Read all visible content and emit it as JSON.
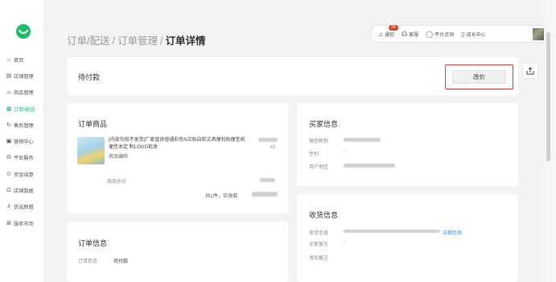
{
  "sidebar": {
    "items": [
      {
        "label": "首页",
        "icon": "home-icon",
        "glyph": "⌂",
        "active": false
      },
      {
        "label": "店铺管理",
        "icon": "shop-icon",
        "glyph": "▤",
        "active": false
      },
      {
        "label": "商品管理",
        "icon": "bag-icon",
        "glyph": "⌓",
        "active": false
      },
      {
        "label": "订单/配送",
        "icon": "order-icon",
        "glyph": "▦",
        "active": true
      },
      {
        "label": "售后管理",
        "icon": "refund-icon",
        "glyph": "↻",
        "active": false
      },
      {
        "label": "营销中心",
        "icon": "marketing-icon",
        "glyph": "▣",
        "active": false
      },
      {
        "label": "平台服务",
        "icon": "service-icon",
        "glyph": "⊟",
        "active": false
      },
      {
        "label": "资金结算",
        "icon": "money-icon",
        "glyph": "⊙",
        "active": false
      },
      {
        "label": "店铺数据",
        "icon": "data-icon",
        "glyph": "⊡",
        "active": false
      },
      {
        "label": "优选联盟",
        "icon": "union-icon",
        "glyph": "⅄",
        "active": false
      },
      {
        "label": "服务市场",
        "icon": "market-icon",
        "glyph": "⊞",
        "active": false
      }
    ]
  },
  "breadcrumb": {
    "item1": "订单/配送",
    "item2": "订单管理",
    "current": "订单详情",
    "separator": "/"
  },
  "toolbar": {
    "notify_label": "通知",
    "notify_badge": "34",
    "service_label": "客服",
    "feedback_label": "平台咨询",
    "growth_label": "成长中心"
  },
  "status": {
    "title": "待付款",
    "reprice_label": "改价"
  },
  "products": {
    "title": "订单商品",
    "name": "[内部勿拍不发货]厂家直供普通彩色N次贴自粘文具便利贴便签纸便签本定 制LOGO批发",
    "code_label": "商品编码",
    "qty": "x1",
    "subtotal_label": "商品总价",
    "total_label": "共1件，实收款"
  },
  "order_info": {
    "title": "订单信息",
    "status_label": "订单状态",
    "status_value": "待付款"
  },
  "buyer": {
    "title": "买家信息",
    "wechat_label": "微信昵称",
    "gender_label": "性别",
    "gender_value": "-",
    "region_label": "用户地区"
  },
  "shipping": {
    "title": "收货信息",
    "address_label": "收货信息",
    "detail_link": "详细信息",
    "buyer_msg_label": "买家留言",
    "buyer_msg_value": "-",
    "add_note_label": "添加备注"
  },
  "colors": {
    "accent": "#19be6b",
    "highlight_border": "#e0413c",
    "badge": "#ed4014"
  }
}
